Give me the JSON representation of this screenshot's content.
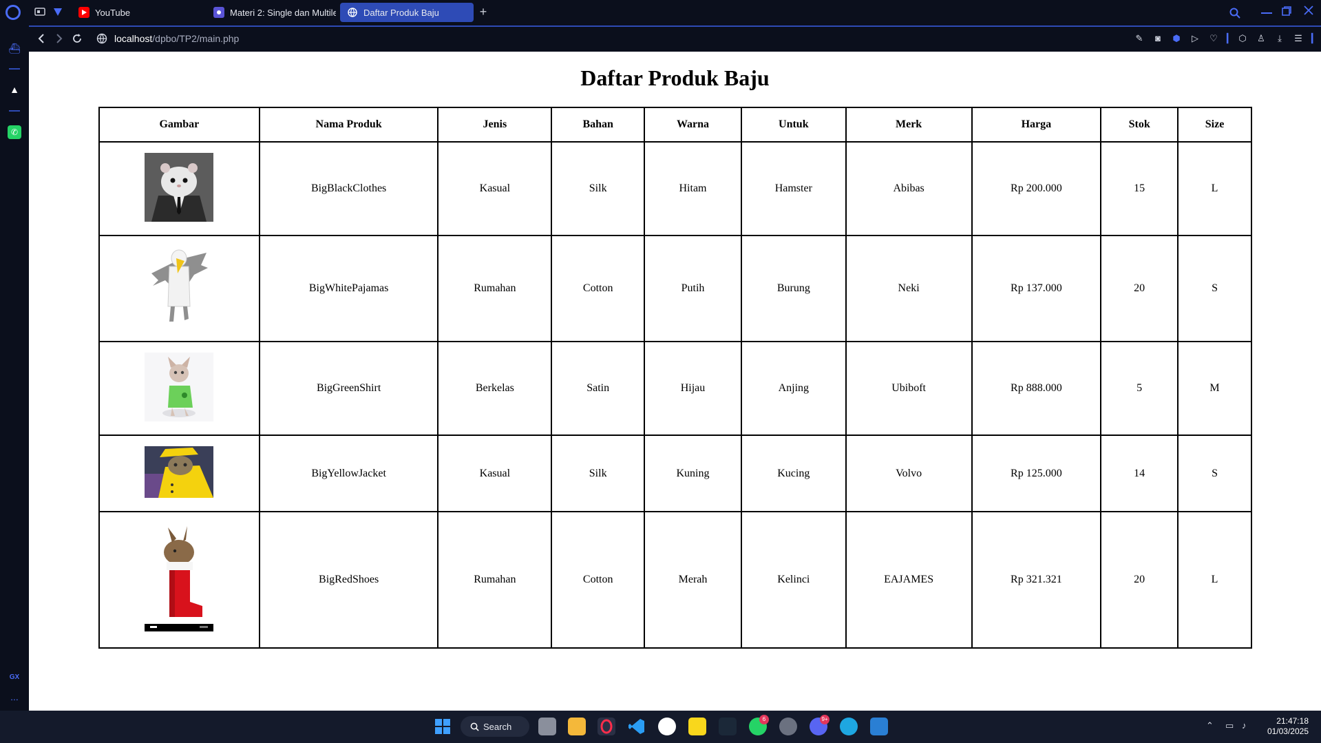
{
  "browser": {
    "tabs": [
      {
        "title": "YouTube",
        "active": false,
        "favicon_color": "#ff0000"
      },
      {
        "title": "Materi 2: Single dan Multile",
        "active": false,
        "favicon_color": "#5a54d6"
      },
      {
        "title": "Daftar Produk Baju",
        "active": true,
        "favicon_color": "#ffffff"
      }
    ],
    "new_tab_label": "+",
    "url_host": "localhost",
    "url_path": "/dpbo/TP2/main.php",
    "accent": "#2e4bb6"
  },
  "sidebar": {
    "bottom_label": "GX",
    "more_label": "..."
  },
  "page": {
    "title": "Daftar Produk Baju",
    "columns": [
      "Gambar",
      "Nama Produk",
      "Jenis",
      "Bahan",
      "Warna",
      "Untuk",
      "Merk",
      "Harga",
      "Stok",
      "Size"
    ],
    "rows": [
      {
        "image": "hamster-in-suit",
        "nama": "BigBlackClothes",
        "jenis": "Kasual",
        "bahan": "Silk",
        "warna": "Hitam",
        "untuk": "Hamster",
        "merk": "Abibas",
        "harga": "Rp 200.000",
        "stok": "15",
        "size": "L"
      },
      {
        "image": "bird-costume-pajamas",
        "nama": "BigWhitePajamas",
        "jenis": "Rumahan",
        "bahan": "Cotton",
        "warna": "Putih",
        "untuk": "Burung",
        "merk": "Neki",
        "harga": "Rp 137.000",
        "stok": "20",
        "size": "S"
      },
      {
        "image": "sphynx-cat-green-shirt",
        "nama": "BigGreenShirt",
        "jenis": "Berkelas",
        "bahan": "Satin",
        "warna": "Hijau",
        "untuk": "Anjing",
        "merk": "Ubiboft",
        "harga": "Rp 888.000",
        "stok": "5",
        "size": "M"
      },
      {
        "image": "cat-yellow-raincoat",
        "nama": "BigYellowJacket",
        "jenis": "Kasual",
        "bahan": "Silk",
        "warna": "Kuning",
        "untuk": "Kucing",
        "merk": "Volvo",
        "harga": "Rp 125.000",
        "stok": "14",
        "size": "S"
      },
      {
        "image": "rabbit-in-red-boot",
        "nama": "BigRedShoes",
        "jenis": "Rumahan",
        "bahan": "Cotton",
        "warna": "Merah",
        "untuk": "Kelinci",
        "merk": "EAJAMES",
        "harga": "Rp 321.321",
        "stok": "20",
        "size": "L"
      }
    ]
  },
  "taskbar": {
    "search_label": "Search",
    "time": "21:47:18",
    "date": "01/03/2025",
    "badge_whatsapp": "6",
    "badge_discord": "9+"
  }
}
